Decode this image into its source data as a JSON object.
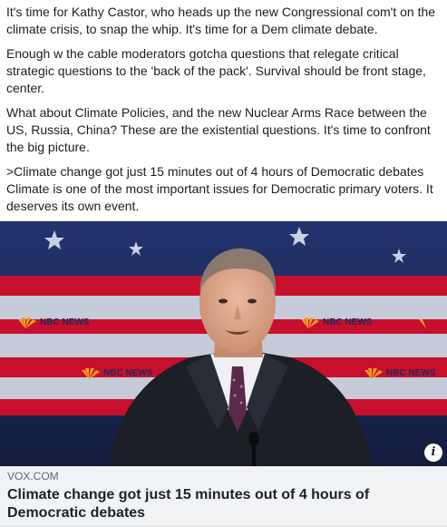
{
  "post": {
    "paragraphs": [
      "It's time for Kathy Castor, who heads up the new Congressional com't on the climate crisis, to snap the whip. It's time for a Dem climate debate.",
      "Enough w the cable moderators gotcha questions that relegate critical strategic questions to the 'back of the pack'. Survival should be front stage, center.",
      "What about Climate Policies, and the new Nuclear Arms Race between the US, Russia, China? These are the existential questions. It's time to confront the big picture.",
      ">Climate change got just 15 minutes out of 4 hours of Democratic debates Climate is one of the most important issues for Democratic primary voters. It deserves its own event."
    ]
  },
  "link_card": {
    "domain": "VOX.COM",
    "headline": "Climate change got just 15 minutes out of 4 hours of Democratic debates",
    "info_icon": "i",
    "image": {
      "logos": [
        "NBC NEWS",
        "NBC NEWS",
        "NBC NEWS",
        "NBC NEWS",
        "NBC NEWS"
      ],
      "colors": {
        "stripe_red": "#c8102e",
        "backdrop_blue": "#1b2a5a",
        "suit": "#1d1f26"
      }
    }
  }
}
